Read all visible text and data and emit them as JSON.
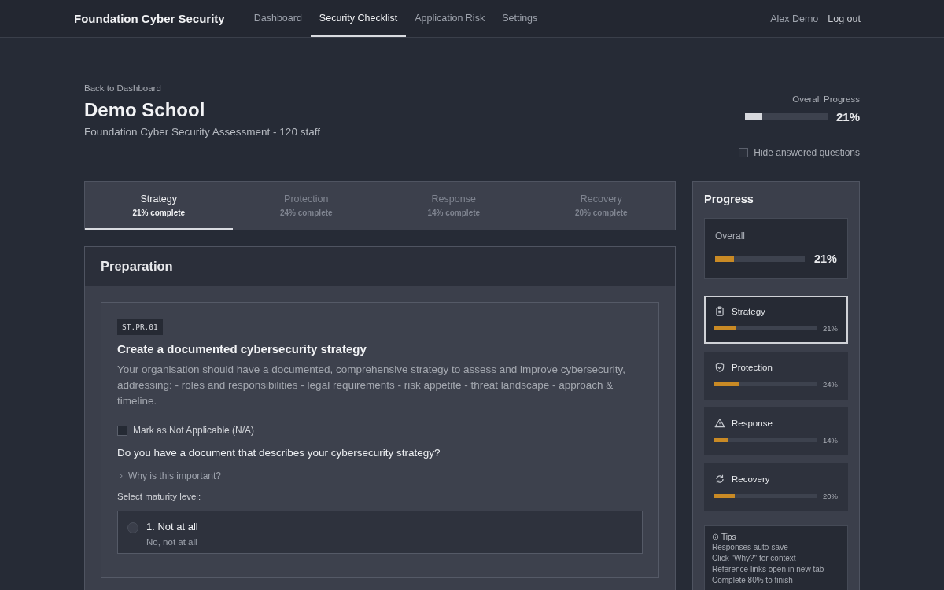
{
  "nav": {
    "brand": "Foundation Cyber Security",
    "links": [
      {
        "label": "Dashboard",
        "selected": false
      },
      {
        "label": "Security Checklist",
        "selected": true
      },
      {
        "label": "Application Risk",
        "selected": false
      },
      {
        "label": "Settings",
        "selected": false
      }
    ],
    "user": "Alex Demo",
    "logout": "Log out"
  },
  "header": {
    "back": "Back to Dashboard",
    "title": "Demo School",
    "subtitle": "Foundation Cyber Security Assessment - 120 staff"
  },
  "overall_progress": {
    "label": "Overall Progress",
    "level": 0.21,
    "reading": "21%"
  },
  "hide_answered": {
    "label": "Hide answered questions",
    "checked": false
  },
  "tabs": [
    {
      "label": "Strategy",
      "subtitle": "21% complete",
      "selected": true
    },
    {
      "label": "Protection",
      "subtitle": "24% complete",
      "selected": false
    },
    {
      "label": "Response",
      "subtitle": "14% complete",
      "selected": false
    },
    {
      "label": "Recovery",
      "subtitle": "20% complete",
      "selected": false
    }
  ],
  "section": {
    "title": "Preparation",
    "question": {
      "code": "ST.PR.01",
      "title": "Create a documented cybersecurity strategy",
      "description": "Your organisation should have a documented, comprehensive strategy to assess and improve cybersecurity, addressing: - roles and responsibilities - legal requirements - risk appetite - threat landscape - approach & timeline.",
      "not_applicable": {
        "label": "Mark as Not Applicable (N/A)",
        "checked": false
      },
      "prompt": "Do you have a document that describes your cybersecurity strategy?",
      "why": {
        "label": "Why is this important?",
        "expanded": false
      },
      "maturity_label": "Select maturity level:",
      "options": [
        {
          "label": "1. Not at all",
          "description": "No, not at all",
          "selected": false
        }
      ]
    }
  },
  "sidebar": {
    "title": "Progress",
    "overall": {
      "label": "Overall",
      "level": 0.21,
      "reading": "21%"
    },
    "categories": [
      {
        "kind": "clipboard",
        "label": "Strategy",
        "level": 0.21,
        "reading": "21%",
        "selected": true
      },
      {
        "kind": "shield",
        "label": "Protection",
        "level": 0.24,
        "reading": "24%",
        "selected": false
      },
      {
        "kind": "warning",
        "label": "Response",
        "level": 0.14,
        "reading": "14%",
        "selected": false
      },
      {
        "kind": "refresh",
        "label": "Recovery",
        "level": 0.2,
        "reading": "20%",
        "selected": false
      }
    ],
    "tips": {
      "title": "Tips",
      "items": [
        "Responses auto-save",
        "Click \"Why?\" for context",
        "Reference links open in new tab",
        "Complete 80% to finish"
      ]
    }
  }
}
